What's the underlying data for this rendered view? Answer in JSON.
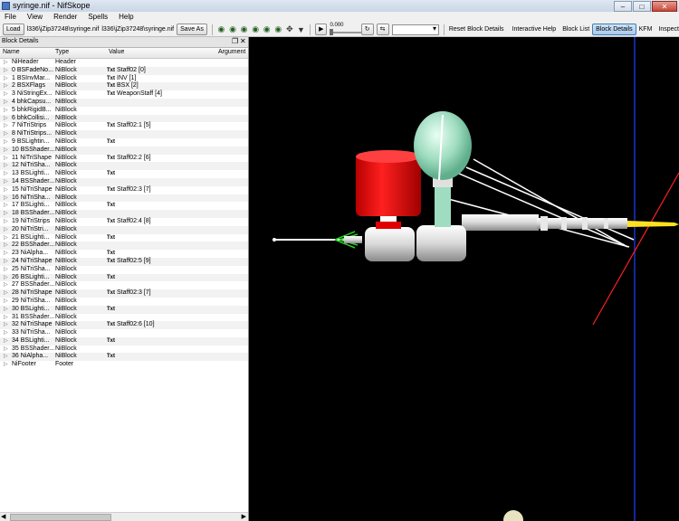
{
  "window": {
    "title": "syringe.nif - NifSkope",
    "minimize": "–",
    "maximize": "□",
    "close": "✕"
  },
  "menu": [
    "File",
    "View",
    "Render",
    "Spells",
    "Help"
  ],
  "toolbar": {
    "load_label": "Load",
    "load_path": "l336\\jZip37248\\syringe.nif",
    "save_path": "l336\\jZip37248\\syringe.nif",
    "save_as_label": "Save As",
    "time_value": "0.000",
    "reset_block_details": "Reset Block Details",
    "interactive_help": "Interactive Help",
    "block_list": "Block List",
    "block_details": "Block Details",
    "kfm": "KFM",
    "inspect": "Inspect",
    "icons": [
      "view-walk-icon",
      "view-top-icon",
      "view-front-icon",
      "view-side-icon",
      "view-user-icon",
      "view-flip-icon",
      "move-icon",
      "dropdown-icon"
    ]
  },
  "panel": {
    "title": "Block Details",
    "float_glyph": "❐",
    "close_glyph": "✕",
    "columns": [
      "Name",
      "Type",
      "Value",
      "Argument"
    ],
    "rows": [
      {
        "name": "NiHeader",
        "type": "Header",
        "txt": "",
        "value": ""
      },
      {
        "name": "0 BSFadeNo...",
        "type": "NiBlock",
        "txt": "Txt",
        "value": "Staff02 [0]"
      },
      {
        "name": "1 BSInvMar...",
        "type": "NiBlock",
        "txt": "Txt",
        "value": "INV [1]"
      },
      {
        "name": "2 BSXFlags",
        "type": "NiBlock",
        "txt": "Txt",
        "value": "BSX [2]"
      },
      {
        "name": "3 NiStringEx...",
        "type": "NiBlock",
        "txt": "Txt",
        "value": "WeaponStaff [4]"
      },
      {
        "name": "4 bhkCapsu...",
        "type": "NiBlock",
        "txt": "",
        "value": ""
      },
      {
        "name": "5 bhkRigidB...",
        "type": "NiBlock",
        "txt": "",
        "value": ""
      },
      {
        "name": "6 bhkCollisi...",
        "type": "NiBlock",
        "txt": "",
        "value": ""
      },
      {
        "name": "7 NiTriStrips",
        "type": "NiBlock",
        "txt": "Txt",
        "value": "Staff02:1 [5]"
      },
      {
        "name": "8 NiTriStrips...",
        "type": "NiBlock",
        "txt": "",
        "value": ""
      },
      {
        "name": "9 BSLightin...",
        "type": "NiBlock",
        "txt": "Txt",
        "value": ""
      },
      {
        "name": "10 BSShader...",
        "type": "NiBlock",
        "txt": "",
        "value": ""
      },
      {
        "name": "11 NiTriShape",
        "type": "NiBlock",
        "txt": "Txt",
        "value": "Staff02:2 [6]"
      },
      {
        "name": "12 NiTriSha...",
        "type": "NiBlock",
        "txt": "",
        "value": ""
      },
      {
        "name": "13 BSLighti...",
        "type": "NiBlock",
        "txt": "Txt",
        "value": ""
      },
      {
        "name": "14 BSShader...",
        "type": "NiBlock",
        "txt": "",
        "value": ""
      },
      {
        "name": "15 NiTriShape",
        "type": "NiBlock",
        "txt": "Txt",
        "value": "Staff02:3 [7]"
      },
      {
        "name": "16 NiTriSha...",
        "type": "NiBlock",
        "txt": "",
        "value": ""
      },
      {
        "name": "17 BSLighti...",
        "type": "NiBlock",
        "txt": "Txt",
        "value": ""
      },
      {
        "name": "18 BSShader...",
        "type": "NiBlock",
        "txt": "",
        "value": ""
      },
      {
        "name": "19 NiTriStrips",
        "type": "NiBlock",
        "txt": "Txt",
        "value": "Staff02:4 [8]"
      },
      {
        "name": "20 NiTriStri...",
        "type": "NiBlock",
        "txt": "",
        "value": ""
      },
      {
        "name": "21 BSLighti...",
        "type": "NiBlock",
        "txt": "Txt",
        "value": ""
      },
      {
        "name": "22 BSShader...",
        "type": "NiBlock",
        "txt": "",
        "value": ""
      },
      {
        "name": "23 NiAlpha...",
        "type": "NiBlock",
        "txt": "Txt",
        "value": ""
      },
      {
        "name": "24 NiTriShape",
        "type": "NiBlock",
        "txt": "Txt",
        "value": "Staff02:5 [9]"
      },
      {
        "name": "25 NiTriSha...",
        "type": "NiBlock",
        "txt": "",
        "value": ""
      },
      {
        "name": "26 BSLighti...",
        "type": "NiBlock",
        "txt": "Txt",
        "value": ""
      },
      {
        "name": "27 BSShader...",
        "type": "NiBlock",
        "txt": "",
        "value": ""
      },
      {
        "name": "28 NiTriShape",
        "type": "NiBlock",
        "txt": "Txt",
        "value": "Staff02:3 [7]"
      },
      {
        "name": "29 NiTriSha...",
        "type": "NiBlock",
        "txt": "",
        "value": ""
      },
      {
        "name": "30 BSLighti...",
        "type": "NiBlock",
        "txt": "Txt",
        "value": ""
      },
      {
        "name": "31 BSShader...",
        "type": "NiBlock",
        "txt": "",
        "value": ""
      },
      {
        "name": "32 NiTriShape",
        "type": "NiBlock",
        "txt": "Txt",
        "value": "Staff02:6 [10]"
      },
      {
        "name": "33 NiTriSha...",
        "type": "NiBlock",
        "txt": "",
        "value": ""
      },
      {
        "name": "34 BSLighti...",
        "type": "NiBlock",
        "txt": "Txt",
        "value": ""
      },
      {
        "name": "35 BSShader...",
        "type": "NiBlock",
        "txt": "",
        "value": ""
      },
      {
        "name": "36 NiAlpha...",
        "type": "NiBlock",
        "txt": "Txt",
        "value": ""
      },
      {
        "name": "NiFooter",
        "type": "Footer",
        "txt": "",
        "value": ""
      }
    ]
  },
  "viewport": {
    "background": "#000000",
    "axis_colors": {
      "x": "#ff2020",
      "y": "#30d030",
      "z": "#2040ff"
    }
  }
}
